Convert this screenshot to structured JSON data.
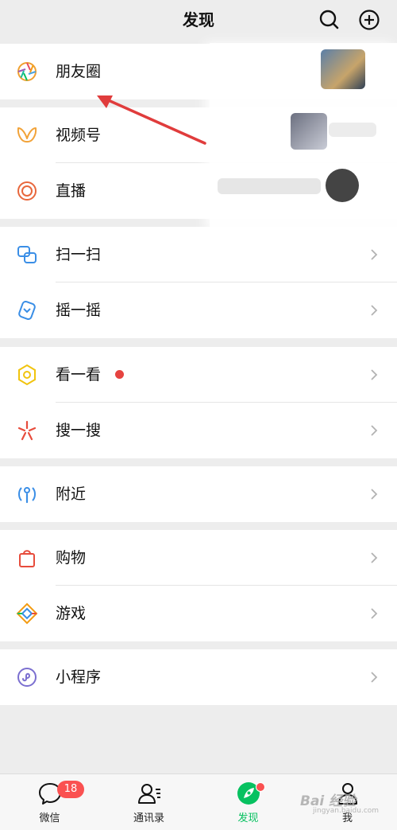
{
  "header": {
    "title": "发现",
    "search_icon": "search-icon",
    "add_icon": "plus-circle-icon"
  },
  "rows": [
    {
      "key": "moments",
      "label": "朋友圈",
      "icon": "moments-aperture-icon"
    },
    {
      "key": "channels",
      "label": "视频号",
      "icon": "channels-butterfly-icon"
    },
    {
      "key": "live",
      "label": "直播",
      "icon": "live-ring-icon"
    },
    {
      "key": "scan",
      "label": "扫一扫",
      "icon": "scan-icon"
    },
    {
      "key": "shake",
      "label": "摇一摇",
      "icon": "shake-icon"
    },
    {
      "key": "top_stories",
      "label": "看一看",
      "icon": "top-stories-icon",
      "red_dot": true
    },
    {
      "key": "search",
      "label": "搜一搜",
      "icon": "search-star-icon"
    },
    {
      "key": "nearby",
      "label": "附近",
      "icon": "nearby-icon"
    },
    {
      "key": "shopping",
      "label": "购物",
      "icon": "shopping-bag-icon"
    },
    {
      "key": "games",
      "label": "游戏",
      "icon": "games-diamond-icon"
    },
    {
      "key": "mini_programs",
      "label": "小程序",
      "icon": "mini-program-icon"
    }
  ],
  "tabbar": {
    "tabs": [
      {
        "label": "微信",
        "icon": "chat-bubble-icon",
        "badge": "18"
      },
      {
        "label": "通讯录",
        "icon": "contacts-icon"
      },
      {
        "label": "发现",
        "icon": "discover-compass-icon",
        "active": true
      },
      {
        "label": "我",
        "icon": "me-person-icon"
      }
    ]
  },
  "watermark": {
    "text": "Bai 经验",
    "sub": "jingyan.baidu.com"
  },
  "colors": {
    "accent_green": "#07c160",
    "badge_red": "#fa5151",
    "arrow_red": "#e03c3c",
    "background": "#ededed"
  }
}
